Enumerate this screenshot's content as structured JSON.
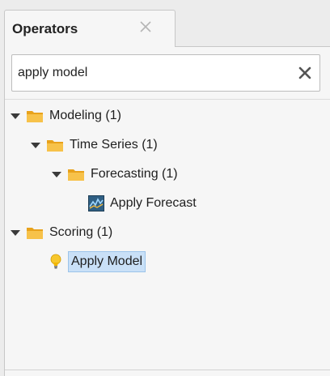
{
  "panel": {
    "tab_title": "Operators",
    "search": {
      "value": "apply model",
      "placeholder": ""
    }
  },
  "tree": {
    "modeling": {
      "label": "Modeling (1)",
      "expanded": true,
      "icon": "folder-icon"
    },
    "time_series": {
      "label": "Time Series (1)",
      "expanded": true,
      "icon": "folder-icon"
    },
    "forecasting": {
      "label": "Forecasting (1)",
      "expanded": true,
      "icon": "folder-icon"
    },
    "apply_forecast": {
      "label": "Apply Forecast",
      "icon": "forecast-operator-icon"
    },
    "scoring": {
      "label": "Scoring (1)",
      "expanded": true,
      "icon": "folder-icon"
    },
    "apply_model": {
      "label": "Apply Model",
      "icon": "lightbulb-icon",
      "selected": true
    }
  },
  "colors": {
    "folder": "#f5b93a",
    "selection": "#c9e0f7",
    "panel_bg": "#f6f6f6"
  }
}
